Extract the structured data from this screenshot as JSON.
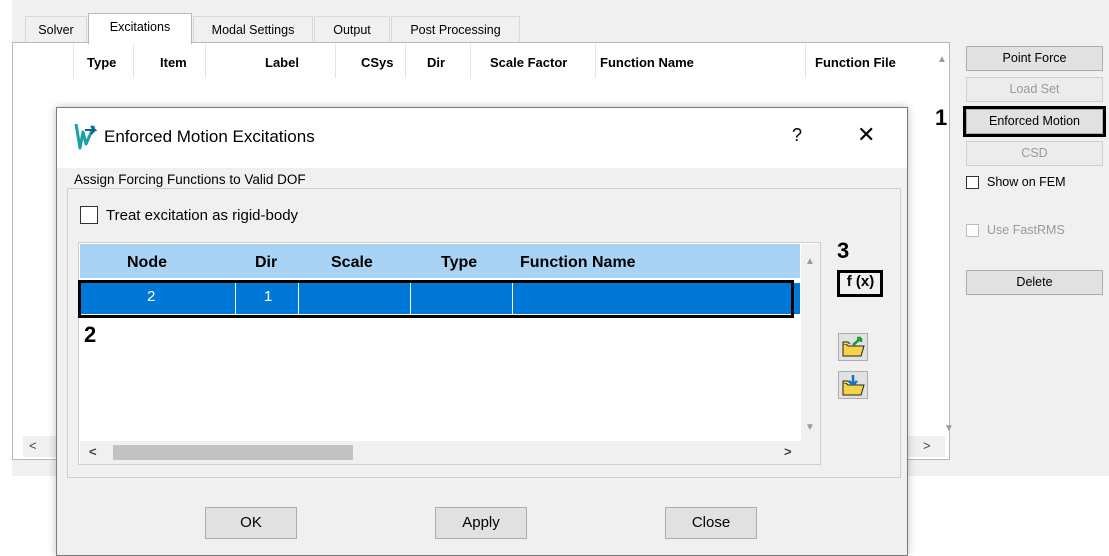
{
  "tabs": [
    "Solver",
    "Excitations",
    "Modal Settings",
    "Output",
    "Post Processing"
  ],
  "list_columns": [
    "Type",
    "Item",
    "Label",
    "CSys",
    "Dir",
    "Scale Factor",
    "Function Name",
    "Function File"
  ],
  "right_panel": {
    "point_force": "Point Force",
    "load_set": "Load Set",
    "enforced_motion": "Enforced Motion",
    "csd": "CSD",
    "show_on_fem": "Show on FEM",
    "use_fastrms": "Use FastRMS",
    "delete": "Delete"
  },
  "dialog": {
    "title": "Enforced Motion Excitations",
    "help": "?",
    "close": "✕",
    "group_label": "Assign Forcing Functions to Valid DOF",
    "rigid_body_label": "Treat excitation as rigid-body",
    "grid_columns": [
      "Node",
      "Dir",
      "Scale",
      "Type",
      "Function Name"
    ],
    "row": {
      "node": "2",
      "dir": "1",
      "scale": "",
      "type": "",
      "function_name": ""
    },
    "fx_label": "f (x)",
    "ok": "OK",
    "apply": "Apply",
    "close_btn": "Close"
  },
  "annotations": [
    "1",
    "2",
    "3"
  ],
  "colors": {
    "selection": "#0078d7",
    "grid_header": "#a9d3f5"
  }
}
